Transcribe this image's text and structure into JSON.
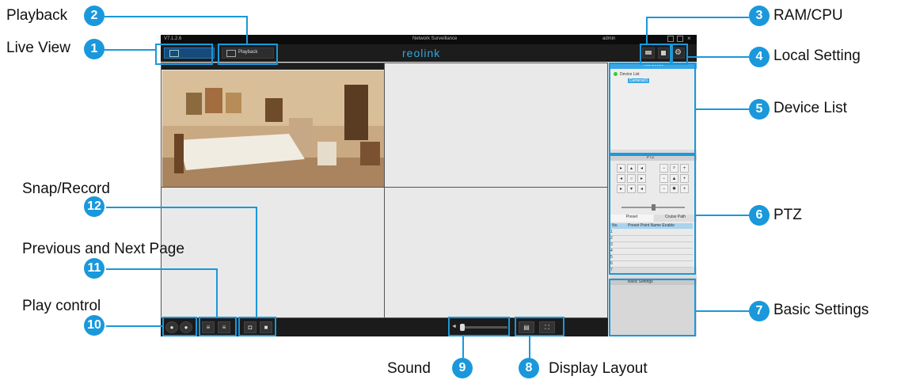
{
  "app": {
    "version": "V7.1.2.6",
    "window_title": "Network Surveillance",
    "user_status": "admin",
    "toolbar": {
      "liveview_tab": "Live View",
      "playback_tab": "Playback",
      "logo": "reolink"
    },
    "device_panel": {
      "header": "Add Device",
      "root": "Device List",
      "device": "Camera01"
    },
    "ptz": {
      "title": "PTZ",
      "tab_preset": "Preset",
      "tab_cruise": "Cruise Path",
      "col_no": "No.",
      "col_header": "Preset Point Name Enable",
      "rows": [
        "1",
        "2",
        "3",
        "4",
        "5",
        "6",
        "7"
      ]
    },
    "basic_settings": {
      "title": "Basic Settings"
    }
  },
  "callouts": {
    "c1": {
      "num": "1",
      "text": "Live View"
    },
    "c2": {
      "num": "2",
      "text": "Playback"
    },
    "c3": {
      "num": "3",
      "text": "RAM/CPU"
    },
    "c4": {
      "num": "4",
      "text": "Local Setting"
    },
    "c5": {
      "num": "5",
      "text": "Device List"
    },
    "c6": {
      "num": "6",
      "text": "PTZ"
    },
    "c7": {
      "num": "7",
      "text": "Basic Settings"
    },
    "c8": {
      "num": "8",
      "text": "Display Layout"
    },
    "c9": {
      "num": "9",
      "text": "Sound"
    },
    "c10": {
      "num": "10",
      "text": "Play control"
    },
    "c11": {
      "num": "11",
      "text": "Previous and Next Page"
    },
    "c12": {
      "num": "12",
      "text": "Snap/Record"
    }
  },
  "colors": {
    "accent": "#1a98db",
    "logo": "#30a9e0",
    "dark": "#1b1b1b"
  }
}
